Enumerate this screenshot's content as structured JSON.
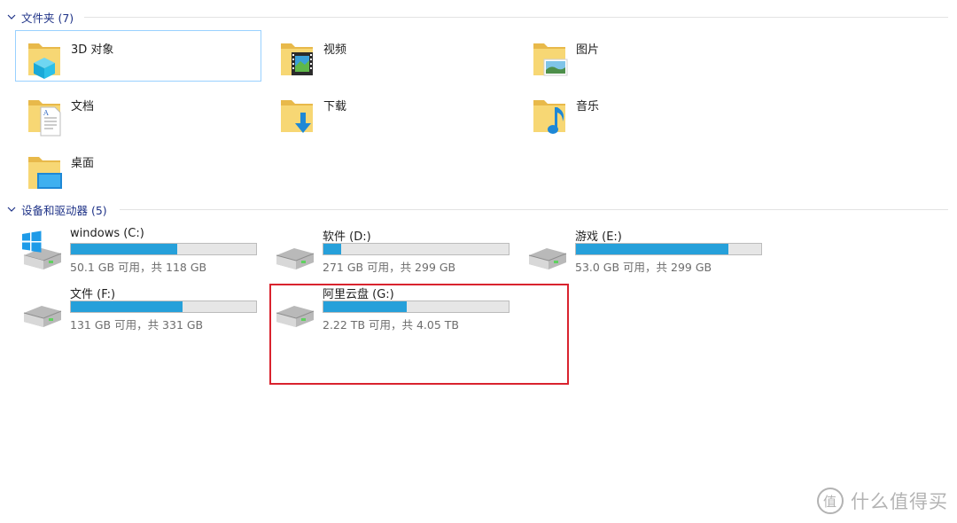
{
  "folders_section": {
    "label": "文件夹 (7)",
    "items": [
      {
        "name": "3D 对象",
        "icon": "3d-objects-icon"
      },
      {
        "name": "视频",
        "icon": "video-icon"
      },
      {
        "name": "图片",
        "icon": "pictures-icon"
      },
      {
        "name": "文档",
        "icon": "documents-icon"
      },
      {
        "name": "下载",
        "icon": "downloads-icon"
      },
      {
        "name": "音乐",
        "icon": "music-icon"
      },
      {
        "name": "桌面",
        "icon": "desktop-icon"
      }
    ]
  },
  "devices_section": {
    "label": "设备和驱动器 (5)",
    "drives": [
      {
        "name": "windows (C:)",
        "info": "50.1 GB 可用，共 118 GB",
        "used_fraction": 0.575
      },
      {
        "name": "软件 (D:)",
        "info": "271 GB 可用，共 299 GB",
        "used_fraction": 0.094
      },
      {
        "name": "游戏 (E:)",
        "info": "53.0 GB 可用，共 299 GB",
        "used_fraction": 0.823
      },
      {
        "name": "文件 (F:)",
        "info": "131 GB 可用，共 331 GB",
        "used_fraction": 0.604
      },
      {
        "name": "阿里云盘 (G:)",
        "info": "2.22 TB 可用，共 4.05 TB",
        "used_fraction": 0.452
      }
    ]
  },
  "colors": {
    "accent": "#26a0da",
    "header_text": "#1e3287",
    "annotation": "#d9232e"
  },
  "watermark": {
    "logo_char": "值",
    "text": "什么值得买"
  }
}
